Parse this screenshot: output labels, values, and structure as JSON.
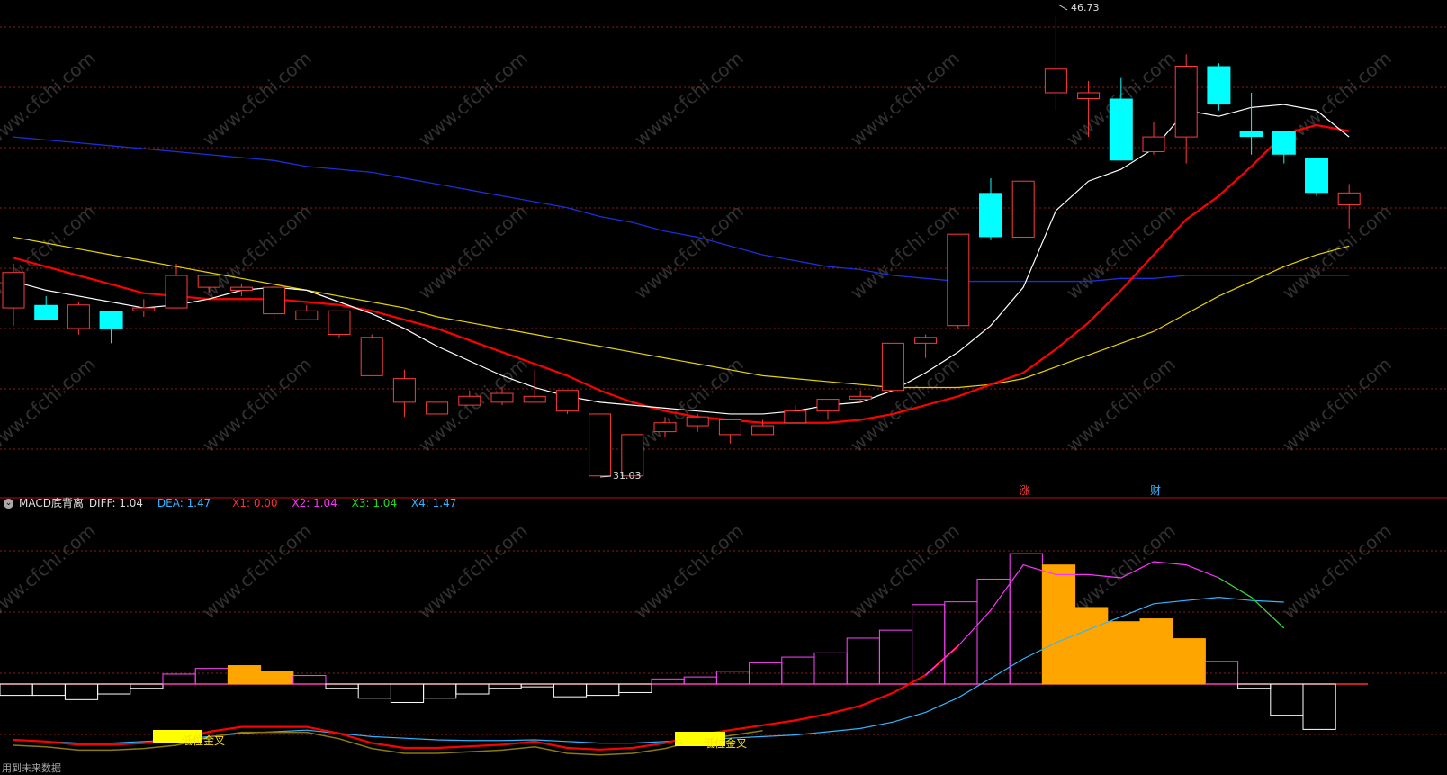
{
  "colors": {
    "background": "#000000",
    "up": "#ff3b3b",
    "down": "#00ffff",
    "grid": "#8b1a1a",
    "ma5": "#ffffff",
    "ma10": "#ff0000",
    "ma20": "#e6d400",
    "ma60": "#1c2fd6",
    "hist_up_hollow": "#ff44ff",
    "hist_up_filled": "#ffa500",
    "hist_down": "#ffffff",
    "diff": "#ff0000",
    "dea": "#33b5ff",
    "x1": "#ff3030",
    "x2": "#ff33ff",
    "x3": "#22dd22",
    "x4": "#33b5ff",
    "marker": "#ffff00"
  },
  "chart_data": [
    {
      "type": "candlestick",
      "extremes": {
        "high_label": "46.73",
        "low_label": "31.03"
      },
      "markers": [
        "涨",
        "财"
      ],
      "ylim": [
        31,
        47
      ],
      "candles": [
        {
          "o": 36.8,
          "c": 38.0,
          "h": 38.3,
          "l": 36.2
        },
        {
          "o": 36.9,
          "c": 36.4,
          "h": 37.2,
          "l": 36.4
        },
        {
          "o": 36.1,
          "c": 36.9,
          "h": 37.0,
          "l": 35.9
        },
        {
          "o": 36.7,
          "c": 36.1,
          "h": 36.7,
          "l": 35.6
        },
        {
          "o": 36.7,
          "c": 36.8,
          "h": 37.1,
          "l": 36.5
        },
        {
          "o": 36.8,
          "c": 37.9,
          "h": 38.3,
          "l": 36.8
        },
        {
          "o": 37.5,
          "c": 37.9,
          "h": 37.9,
          "l": 37.3
        },
        {
          "o": 37.4,
          "c": 37.5,
          "h": 37.6,
          "l": 37.2
        },
        {
          "o": 36.6,
          "c": 37.5,
          "h": 37.5,
          "l": 36.4
        },
        {
          "o": 36.4,
          "c": 36.7,
          "h": 36.9,
          "l": 36.4
        },
        {
          "o": 35.9,
          "c": 36.7,
          "h": 36.7,
          "l": 35.8
        },
        {
          "o": 34.5,
          "c": 35.8,
          "h": 35.9,
          "l": 34.5
        },
        {
          "o": 33.6,
          "c": 34.4,
          "h": 34.7,
          "l": 33.1
        },
        {
          "o": 33.2,
          "c": 33.6,
          "h": 33.6,
          "l": 33.2
        },
        {
          "o": 33.5,
          "c": 33.8,
          "h": 34.0,
          "l": 33.5
        },
        {
          "o": 33.6,
          "c": 33.9,
          "h": 34.1,
          "l": 33.5
        },
        {
          "o": 33.6,
          "c": 33.8,
          "h": 34.7,
          "l": 33.6
        },
        {
          "o": 33.3,
          "c": 34.0,
          "h": 34.0,
          "l": 33.2
        },
        {
          "o": 31.1,
          "c": 33.2,
          "h": 33.2,
          "l": 31.1
        },
        {
          "o": 31.1,
          "c": 32.5,
          "h": 32.5,
          "l": 31.1
        },
        {
          "o": 32.6,
          "c": 32.9,
          "h": 33.1,
          "l": 32.4
        },
        {
          "o": 32.8,
          "c": 33.1,
          "h": 33.2,
          "l": 32.6
        },
        {
          "o": 32.5,
          "c": 33.0,
          "h": 33.0,
          "l": 32.2
        },
        {
          "o": 32.5,
          "c": 32.8,
          "h": 33.0,
          "l": 32.5
        },
        {
          "o": 32.9,
          "c": 33.3,
          "h": 33.5,
          "l": 32.9
        },
        {
          "o": 33.3,
          "c": 33.7,
          "h": 33.7,
          "l": 33.0
        },
        {
          "o": 33.7,
          "c": 33.8,
          "h": 34.0,
          "l": 33.6
        },
        {
          "o": 34.0,
          "c": 35.6,
          "h": 35.6,
          "l": 34.0
        },
        {
          "o": 35.6,
          "c": 35.8,
          "h": 35.9,
          "l": 35.1
        },
        {
          "o": 36.2,
          "c": 39.3,
          "h": 39.3,
          "l": 36.1
        },
        {
          "o": 40.7,
          "c": 39.2,
          "h": 41.2,
          "l": 39.1
        },
        {
          "o": 39.2,
          "c": 41.1,
          "h": 41.1,
          "l": 39.2
        },
        {
          "o": 44.1,
          "c": 44.9,
          "h": 46.7,
          "l": 43.5
        },
        {
          "o": 43.9,
          "c": 44.1,
          "h": 44.5,
          "l": 42.6
        },
        {
          "o": 43.9,
          "c": 41.8,
          "h": 44.6,
          "l": 41.8
        },
        {
          "o": 42.1,
          "c": 42.6,
          "h": 43.1,
          "l": 42.0
        },
        {
          "o": 42.6,
          "c": 45.0,
          "h": 45.4,
          "l": 41.7
        },
        {
          "o": 45.0,
          "c": 43.7,
          "h": 45.1,
          "l": 43.5
        },
        {
          "o": 42.8,
          "c": 42.6,
          "h": 44.1,
          "l": 42.0
        },
        {
          "o": 42.8,
          "c": 42.0,
          "h": 42.8,
          "l": 41.7
        },
        {
          "o": 41.9,
          "c": 40.7,
          "h": 41.9,
          "l": 40.6
        },
        {
          "o": 40.3,
          "c": 40.7,
          "h": 41.0,
          "l": 39.5
        }
      ],
      "ma5": [
        37.7,
        37.4,
        37.2,
        37.0,
        36.8,
        36.9,
        37.1,
        37.4,
        37.5,
        37.4,
        37.0,
        36.6,
        36.1,
        35.5,
        35.0,
        34.5,
        34.1,
        33.8,
        33.6,
        33.5,
        33.4,
        33.3,
        33.2,
        33.2,
        33.3,
        33.5,
        33.6,
        34.0,
        34.6,
        35.3,
        36.2,
        37.5,
        40.1,
        41.1,
        41.5,
        42.2,
        43.5,
        43.3,
        43.6,
        43.7,
        43.5,
        42.6
      ],
      "ma10": [
        38.5,
        38.2,
        37.9,
        37.6,
        37.3,
        37.2,
        37.1,
        37.1,
        37.1,
        37.0,
        36.9,
        36.7,
        36.4,
        36.1,
        35.7,
        35.3,
        34.9,
        34.5,
        34.0,
        33.6,
        33.3,
        33.1,
        33.0,
        32.9,
        32.9,
        32.9,
        33.0,
        33.2,
        33.5,
        33.8,
        34.2,
        34.6,
        35.4,
        36.3,
        37.4,
        38.6,
        39.8,
        40.6,
        41.6,
        42.7,
        43.0,
        42.8
      ],
      "ma20": [
        39.2,
        39.0,
        38.8,
        38.6,
        38.4,
        38.2,
        38.0,
        37.8,
        37.6,
        37.4,
        37.2,
        37.0,
        36.8,
        36.5,
        36.3,
        36.1,
        35.9,
        35.7,
        35.5,
        35.3,
        35.1,
        34.9,
        34.7,
        34.5,
        34.4,
        34.3,
        34.2,
        34.1,
        34.1,
        34.1,
        34.2,
        34.4,
        34.8,
        35.2,
        35.6,
        36.0,
        36.6,
        37.2,
        37.7,
        38.2,
        38.6,
        38.9
      ],
      "ma60": [
        42.6,
        42.5,
        42.4,
        42.3,
        42.2,
        42.1,
        42.0,
        41.9,
        41.8,
        41.6,
        41.5,
        41.4,
        41.2,
        41.0,
        40.8,
        40.6,
        40.4,
        40.2,
        39.9,
        39.7,
        39.4,
        39.2,
        38.9,
        38.6,
        38.4,
        38.2,
        38.1,
        37.9,
        37.8,
        37.7,
        37.7,
        37.7,
        37.7,
        37.7,
        37.8,
        37.8,
        37.9,
        37.9,
        37.9,
        37.9,
        37.9,
        37.9
      ]
    },
    {
      "type": "macd",
      "title": "MACD底背离",
      "diff": 1.04,
      "dea": 1.47,
      "x1": 0.0,
      "x2": 1.04,
      "x3": 1.04,
      "x4": 1.47,
      "annotations": [
        "低位金叉",
        "低位金叉"
      ],
      "footer": "用到未来数据",
      "ylim": [
        -1.6,
        4.8
      ],
      "hist": [
        -0.4,
        -0.4,
        -0.55,
        -0.35,
        -0.15,
        0.35,
        0.55,
        0.65,
        0.45,
        0.3,
        -0.15,
        -0.5,
        -0.65,
        -0.5,
        -0.35,
        -0.15,
        -0.1,
        -0.45,
        -0.4,
        -0.3,
        0.18,
        0.25,
        0.45,
        0.75,
        0.95,
        1.1,
        1.62,
        1.9,
        2.8,
        2.9,
        3.7,
        4.6,
        4.2,
        2.7,
        2.2,
        2.3,
        1.6,
        0.8,
        -0.15,
        -1.1,
        -1.6
      ],
      "diff_line": [
        -1.7,
        -1.75,
        -1.85,
        -1.85,
        -1.8,
        -1.7,
        -1.45,
        -1.3,
        -1.3,
        -1.3,
        -1.5,
        -1.8,
        -1.95,
        -1.95,
        -1.9,
        -1.85,
        -1.75,
        -1.95,
        -2.0,
        -1.95,
        -1.8,
        -1.55,
        -1.4,
        -1.25,
        -1.1,
        -0.9,
        -0.65,
        -0.25,
        0.3,
        1.2,
        2.3,
        3.7,
        3.4,
        3.4,
        3.3,
        3.8,
        3.7,
        3.3,
        2.7,
        1.75
      ],
      "dea_line": [
        -1.7,
        -1.75,
        -1.8,
        -1.8,
        -1.75,
        -1.7,
        -1.6,
        -1.5,
        -1.45,
        -1.4,
        -1.5,
        -1.6,
        -1.65,
        -1.7,
        -1.72,
        -1.72,
        -1.7,
        -1.75,
        -1.8,
        -1.8,
        -1.75,
        -1.7,
        -1.65,
        -1.6,
        -1.55,
        -1.45,
        -1.35,
        -1.15,
        -0.85,
        -0.4,
        0.2,
        0.8,
        1.3,
        1.7,
        2.1,
        2.5,
        2.6,
        2.7,
        2.6,
        2.55
      ]
    }
  ]
}
